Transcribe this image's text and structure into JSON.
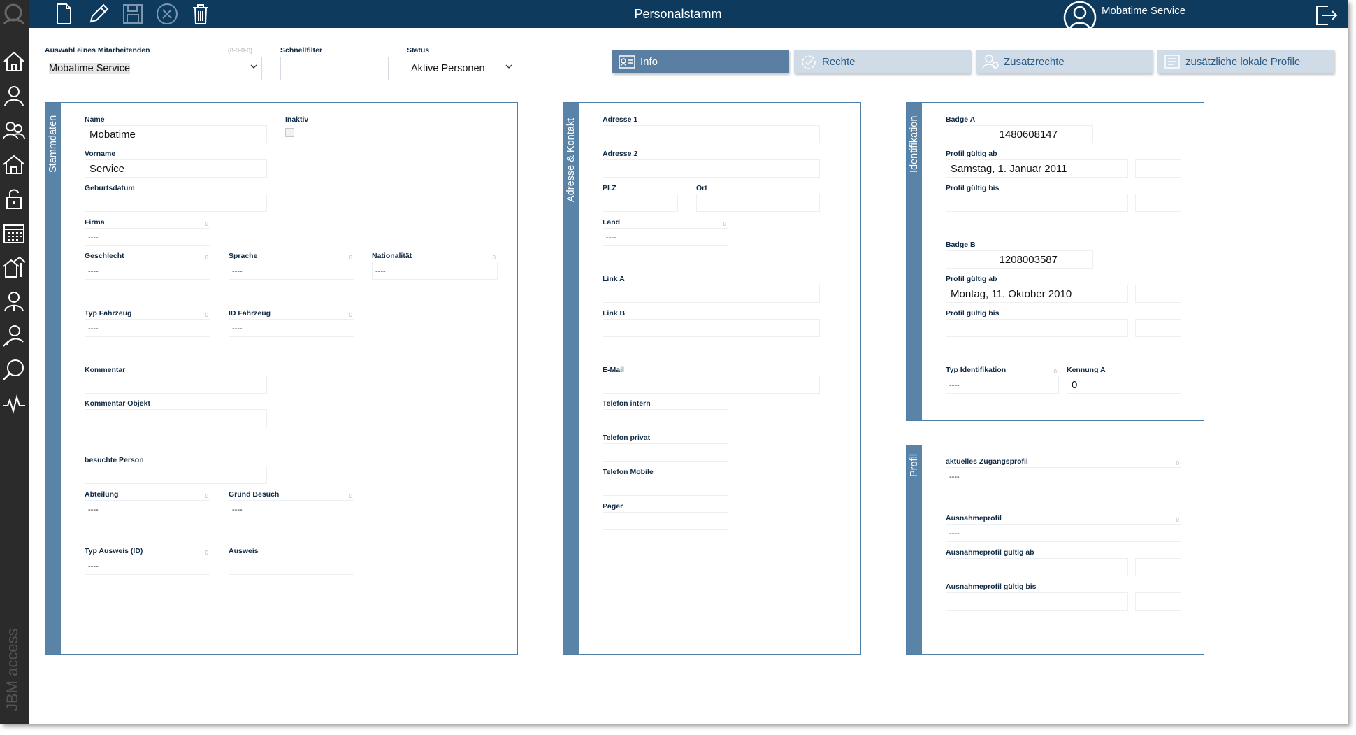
{
  "app": {
    "title": "Personalstamm",
    "user": "Mobatime Service",
    "vendor": "JBM access"
  },
  "toolbar": [
    "new-document-icon",
    "edit-pencil-icon",
    "save-icon",
    "cancel-icon",
    "delete-trash-icon"
  ],
  "filters": {
    "employee_label": "Auswahl eines Mitarbeitenden",
    "employee_hint": "(8-0-0-0)",
    "employee_value": "Mobatime Service",
    "quickfilter_label": "Schnellfilter",
    "quickfilter_value": "",
    "status_label": "Status",
    "status_value": "Aktive Personen"
  },
  "tabs": [
    {
      "label": "Info",
      "active": true
    },
    {
      "label": "Rechte",
      "active": false
    },
    {
      "label": "Zusatzrechte",
      "active": false
    },
    {
      "label": "zusätzliche lokale Profile",
      "active": false
    }
  ],
  "stammdaten": {
    "title": "Stammdaten",
    "name_label": "Name",
    "name_value": "Mobatime",
    "inaktiv_label": "Inaktiv",
    "vorname_label": "Vorname",
    "vorname_value": "Service",
    "geburtsdatum_label": "Geburtsdatum",
    "firma_label": "Firma",
    "firma_value": "----",
    "geschlecht_label": "Geschlecht",
    "geschlecht_value": "----",
    "sprache_label": "Sprache",
    "sprache_value": "----",
    "nationalitaet_label": "Nationalität",
    "nationalitaet_value": "----",
    "typ_fahrzeug_label": "Typ Fahrzeug",
    "typ_fahrzeug_value": "----",
    "id_fahrzeug_label": "ID Fahrzeug",
    "id_fahrzeug_value": "----",
    "kommentar_label": "Kommentar",
    "kommentar_objekt_label": "Kommentar Objekt",
    "besuchte_person_label": "besuchte Person",
    "abteilung_label": "Abteilung",
    "abteilung_value": "----",
    "grund_besuch_label": "Grund Besuch",
    "grund_besuch_value": "----",
    "typ_ausweis_label": "Typ Ausweis (ID)",
    "typ_ausweis_value": "----",
    "ausweis_label": "Ausweis"
  },
  "adresse": {
    "title": "Adresse & Kontakt",
    "adresse1_label": "Adresse 1",
    "adresse2_label": "Adresse 2",
    "plz_label": "PLZ",
    "ort_label": "Ort",
    "land_label": "Land",
    "land_value": "----",
    "link_a_label": "Link A",
    "link_b_label": "Link B",
    "email_label": "E-Mail",
    "tel_intern_label": "Telefon intern",
    "tel_privat_label": "Telefon privat",
    "tel_mobile_label": "Telefon Mobile",
    "pager_label": "Pager"
  },
  "identifikation": {
    "title": "Identifikation",
    "badge_a_label": "Badge A",
    "badge_a_value": "1480608147",
    "profil_ab_a_label": "Profil gültig ab",
    "profil_ab_a_value": "Samstag, 1. Januar 2011",
    "profil_bis_a_label": "Profil gültig bis",
    "badge_b_label": "Badge B",
    "badge_b_value": "1208003587",
    "profil_ab_b_label": "Profil gültig ab",
    "profil_ab_b_value": "Montag, 11. Oktober 2010",
    "profil_bis_b_label": "Profil gültig bis",
    "typ_ident_label": "Typ Identifikation",
    "typ_ident_value": "----",
    "kennung_a_label": "Kennung A",
    "kennung_a_value": "0"
  },
  "profil": {
    "title": "Profil",
    "aktuelles_label": "aktuelles Zugangsprofil",
    "aktuelles_value": "----",
    "ausnahme_label": "Ausnahmeprofil",
    "ausnahme_value": "----",
    "ausnahme_ab_label": "Ausnahmeprofil gültig ab",
    "ausnahme_bis_label": "Ausnahmeprofil gültig bis"
  },
  "colors": {
    "topbar": "#0e3a5e",
    "sidebar": "#2b2b2b",
    "band": "#5a83a8",
    "tab_active": "#5b7fa3",
    "tab_inactive": "#cfdbe6"
  }
}
